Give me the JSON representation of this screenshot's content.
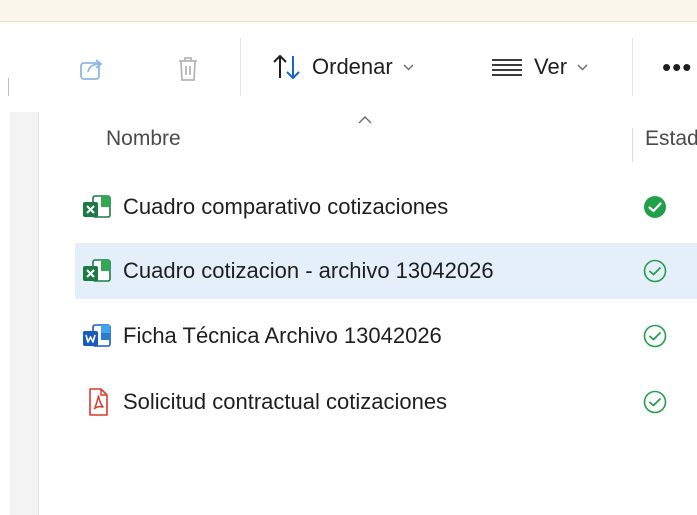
{
  "toolbar": {
    "share_icon": "share-icon",
    "delete_icon": "trash-icon",
    "sort_label": "Ordenar",
    "view_label": "Ver",
    "more_label": "•••"
  },
  "columns": {
    "name": "Nombre",
    "status": "Estado"
  },
  "files": [
    {
      "name": "Cuadro comparativo cotizaciones",
      "type": "excel",
      "status": "available-on-device",
      "selected": false
    },
    {
      "name": "Cuadro cotizacion - archivo 13042026",
      "type": "excel",
      "status": "available",
      "selected": true
    },
    {
      "name": "Ficha Técnica Archivo 13042026",
      "type": "word",
      "status": "available",
      "selected": false
    },
    {
      "name": "Solicitud contractual cotizaciones",
      "type": "pdf",
      "status": "available",
      "selected": false
    }
  ],
  "colors": {
    "selection": "#e4eff9",
    "status_green": "#21a049",
    "excel_green": "#1d7a45",
    "word_blue": "#185abd",
    "pdf_red": "#d93b2b",
    "sort_icon_blue": "#1a66c9"
  }
}
